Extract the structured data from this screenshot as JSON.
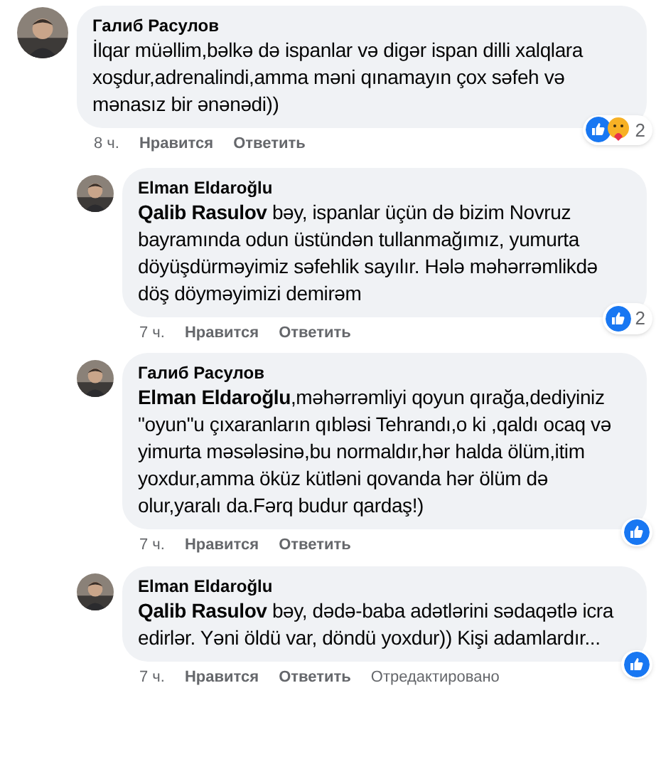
{
  "comments": [
    {
      "author": "Галиб Расулов",
      "text": "İlqar müəllim,bəlkə də ispanlar və digər ispan dilli xalqlara xoşdur,adrenalindi,amma məni qınamayın çox səfeh və mənasız bir ənənədi))",
      "time": "8 ч.",
      "like": "Нравится",
      "reply": "Ответить",
      "reactions": [
        {
          "kind": "like"
        },
        {
          "kind": "care"
        }
      ],
      "reaction_count": "2",
      "children": [
        {
          "author": "Elman Eldaroğlu",
          "text": "**Qalib Rasulov** bəy, ispanlar üçün də bizim Novruz bayramında odun üstündən tullanmağımız, yumurta döyüşdürməyimiz səfehlik sayılır. Hələ məhərrəmlikdə döş döyməyimizi demirəm",
          "time": "7 ч.",
          "like": "Нравится",
          "reply": "Ответить",
          "reactions": [
            {
              "kind": "like"
            }
          ],
          "reaction_count": "2"
        },
        {
          "author": "Галиб Расулов",
          "text": "**Elman Eldaroğlu**,məhərrəmliyi qoyun qırağa,dediyiniz \"oyun\"u çıxaranların qıbləsi Tehrandı,o ki ,qaldı ocaq və yimurta məsələsinə,bu normaldır,hər halda ölüm,itim yoxdur,amma öküz kütləni qovanda hər ölüm də olur,yaralı da.Fərq budur qardaş!)",
          "time": "7 ч.",
          "like": "Нравится",
          "reply": "Ответить",
          "reactions": [
            {
              "kind": "like"
            }
          ]
        },
        {
          "author": "Elman Eldaroğlu",
          "text": "**Qalib Rasulov** bəy, dədə-baba adətlərini sədaqətlə icra edirlər. Yəni öldü var, döndü yoxdur)) Kişi adamlardır...",
          "time": "7 ч.",
          "like": "Нравится",
          "reply": "Ответить",
          "edited": "Отредактировано",
          "reactions": [
            {
              "kind": "like"
            }
          ]
        }
      ]
    }
  ]
}
